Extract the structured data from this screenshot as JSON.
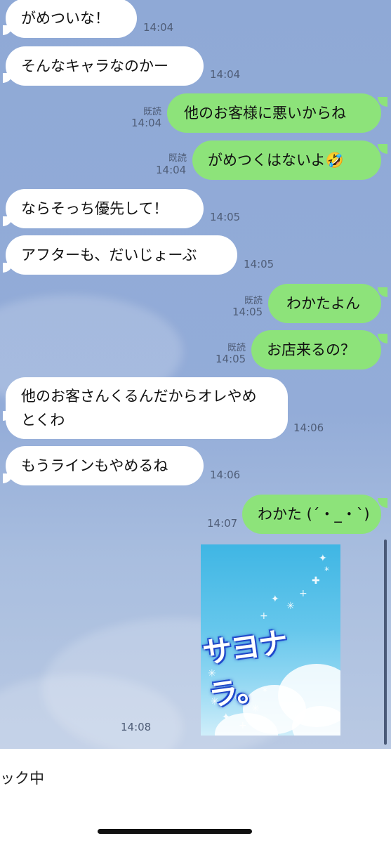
{
  "messages": [
    {
      "text": "がめついな！",
      "time": "14:04"
    },
    {
      "text": "そんなキャラなのかー",
      "time": "14:04"
    },
    {
      "text": "他のお客様に悪いからね",
      "time": "14:04",
      "read": "既読"
    },
    {
      "text": "がめつくはないよ🤣",
      "time": "14:04",
      "read": "既読"
    },
    {
      "text": "ならそっち優先して！",
      "time": "14:05"
    },
    {
      "text": "アフターも、だいじょーぶ",
      "time": "14:05"
    },
    {
      "text": "わかたよん",
      "time": "14:05",
      "read": "既読"
    },
    {
      "text": "お店来るの？",
      "time": "14:05",
      "read": "既読"
    },
    {
      "text": "他のお客さんくるんだからオレやめとくわ",
      "time": "14:06"
    },
    {
      "text": "もうラインもやめるね",
      "time": "14:06"
    },
    {
      "text": "わかた (´・_・`)",
      "time": "14:07"
    }
  ],
  "sticker": {
    "text": "サヨナラ。",
    "time": "14:08"
  },
  "footer": {
    "status": "ック中"
  },
  "colors": {
    "background": "#93acd8",
    "outgoing_bubble": "#8de37a",
    "incoming_bubble": "#ffffff"
  }
}
